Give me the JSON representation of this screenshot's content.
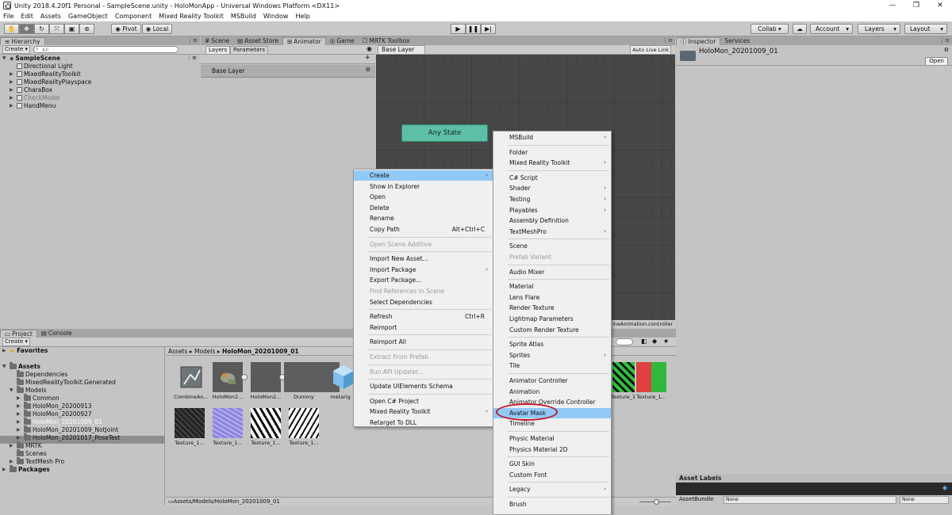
{
  "window": {
    "title": "Unity 2018.4.20f1 Personal - SampleScene.unity - HoloMonApp - Universal Windows Platform <DX11>",
    "min": "—",
    "max": "❐",
    "close": "✕"
  },
  "menubar": [
    "File",
    "Edit",
    "Assets",
    "GameObject",
    "Component",
    "Mixed Reality Toolkit",
    "MSBuild",
    "Window",
    "Help"
  ],
  "toolbar": {
    "pivot": "Pivot",
    "local": "Local",
    "collab": "Collab ▾",
    "account": "Account",
    "layers": "Layers",
    "layout": "Layout",
    "dropdown_arrow": "▾"
  },
  "hierarchy": {
    "tab": "Hierarchy",
    "create": "Create ▾",
    "search": "All",
    "scene": "SampleScene",
    "items": [
      {
        "label": "Directional Light",
        "arrow": "",
        "dim": false
      },
      {
        "label": "MixedRealityToolkit",
        "arrow": "▶",
        "dim": false
      },
      {
        "label": "MixedRealityPlayspace",
        "arrow": "▶",
        "dim": false
      },
      {
        "label": "CharaBox",
        "arrow": "▶",
        "dim": false
      },
      {
        "label": "CheckModel",
        "arrow": "▶",
        "dim": true
      },
      {
        "label": "HandMenu",
        "arrow": "▶",
        "dim": false
      }
    ]
  },
  "center_tabs": [
    "Scene",
    "Asset Store",
    "Animator",
    "Game",
    "MRTK Toolbox"
  ],
  "animator": {
    "layers_tab": "Layers",
    "parameters_tab": "Parameters",
    "base_layer_row": "Base Layer",
    "breadcrumb": "Base Layer",
    "auto_live_link": "Auto Live Link",
    "any_state": "Any State",
    "controller_file": "ineAnimation.controller"
  },
  "inspector": {
    "tabs": [
      "Inspector",
      "Services"
    ],
    "object_name": "HoloMon_20201009_01",
    "open_button": "Open",
    "asset_labels": "Asset Labels",
    "asset_bundle": "AssetBundle",
    "none1": "None",
    "none2": "None"
  },
  "project": {
    "tabs": [
      "Project",
      "Console"
    ],
    "create": "Create ▾",
    "favorites": "Favorites",
    "assets": "Assets",
    "tree": [
      {
        "label": "Dependencies",
        "level": 1,
        "arrow": ""
      },
      {
        "label": "MixedRealityToolkit.Generated",
        "level": 1,
        "arrow": ""
      },
      {
        "label": "Models",
        "level": 1,
        "arrow": "▼"
      },
      {
        "label": "Common",
        "level": 2,
        "arrow": "▶"
      },
      {
        "label": "HoloMon_20200913",
        "level": 2,
        "arrow": "▶"
      },
      {
        "label": "HoloMon_20200927",
        "level": 2,
        "arrow": "▶"
      },
      {
        "label": "HoloMon_20201009_01",
        "level": 2,
        "arrow": "▶",
        "selected": true
      },
      {
        "label": "HoloMon_20201009_NotJoint",
        "level": 2,
        "arrow": "▶"
      },
      {
        "label": "HoloMon_20201017_PoseTest",
        "level": 2,
        "arrow": "▶"
      },
      {
        "label": "MRTK",
        "level": 1,
        "arrow": "▶"
      },
      {
        "label": "Scenes",
        "level": 1,
        "arrow": ""
      },
      {
        "label": "TextMesh Pro",
        "level": 1,
        "arrow": "▶"
      }
    ],
    "packages": "Packages",
    "breadcrumb": [
      "Assets",
      "Models",
      "HoloMon_20201009_01"
    ],
    "row1": [
      "CombineAn...",
      "HoloMon2...",
      "HoloMon2...",
      "Dummy",
      "metarig"
    ],
    "row2": [
      "Texture_1...",
      "Texture_1...",
      "Texture_1...",
      "Texture_1..."
    ],
    "far_right": [
      "Texture_1...",
      "Texture_1..."
    ],
    "status_path": "Assets/Models/HoloMon_20201009_01"
  },
  "context_menu": {
    "items": [
      {
        "label": "Create",
        "sub": true,
        "hl": true
      },
      {
        "label": "Show in Explorer"
      },
      {
        "label": "Open"
      },
      {
        "label": "Delete"
      },
      {
        "label": "Rename"
      },
      {
        "label": "Copy Path",
        "shortcut": "Alt+Ctrl+C"
      },
      {
        "sep": true
      },
      {
        "label": "Open Scene Additive",
        "disabled": true
      },
      {
        "sep": true
      },
      {
        "label": "Import New Asset..."
      },
      {
        "label": "Import Package",
        "sub": true
      },
      {
        "label": "Export Package..."
      },
      {
        "label": "Find References In Scene",
        "disabled": true
      },
      {
        "label": "Select Dependencies"
      },
      {
        "sep": true
      },
      {
        "label": "Refresh",
        "shortcut": "Ctrl+R"
      },
      {
        "label": "Reimport"
      },
      {
        "sep": true
      },
      {
        "label": "Reimport All"
      },
      {
        "sep": true
      },
      {
        "label": "Extract From Prefab",
        "disabled": true
      },
      {
        "sep": true
      },
      {
        "label": "Run API Updater...",
        "disabled": true
      },
      {
        "sep": true
      },
      {
        "label": "Update UIElements Schema"
      },
      {
        "sep": true
      },
      {
        "label": "Open C# Project"
      },
      {
        "label": "Mixed Reality Toolkit",
        "sub": true
      },
      {
        "label": "Retarget To DLL"
      }
    ]
  },
  "create_submenu": {
    "items": [
      {
        "label": "MSBuild",
        "sub": true
      },
      {
        "sep": true
      },
      {
        "label": "Folder"
      },
      {
        "label": "Mixed Reality Toolkit",
        "sub": true
      },
      {
        "sep": true
      },
      {
        "label": "C# Script"
      },
      {
        "label": "Shader",
        "sub": true
      },
      {
        "label": "Testing",
        "sub": true
      },
      {
        "label": "Playables",
        "sub": true
      },
      {
        "label": "Assembly Definition"
      },
      {
        "label": "TextMeshPro",
        "sub": true
      },
      {
        "sep": true
      },
      {
        "label": "Scene"
      },
      {
        "label": "Prefab Variant",
        "disabled": true
      },
      {
        "sep": true
      },
      {
        "label": "Audio Mixer"
      },
      {
        "sep": true
      },
      {
        "label": "Material"
      },
      {
        "label": "Lens Flare"
      },
      {
        "label": "Render Texture"
      },
      {
        "label": "Lightmap Parameters"
      },
      {
        "label": "Custom Render Texture"
      },
      {
        "sep": true
      },
      {
        "label": "Sprite Atlas"
      },
      {
        "label": "Sprites",
        "sub": true
      },
      {
        "label": "Tile"
      },
      {
        "sep": true
      },
      {
        "label": "Animator Controller"
      },
      {
        "label": "Animation"
      },
      {
        "label": "Animator Override Controller"
      },
      {
        "label": "Avatar Mask",
        "hl": true
      },
      {
        "label": "Timeline"
      },
      {
        "sep": true
      },
      {
        "label": "Physic Material"
      },
      {
        "label": "Physics Material 2D"
      },
      {
        "sep": true
      },
      {
        "label": "GUI Skin"
      },
      {
        "label": "Custom Font"
      },
      {
        "sep": true
      },
      {
        "label": "Legacy",
        "sub": true
      },
      {
        "sep": true
      },
      {
        "label": "Brush"
      }
    ]
  }
}
